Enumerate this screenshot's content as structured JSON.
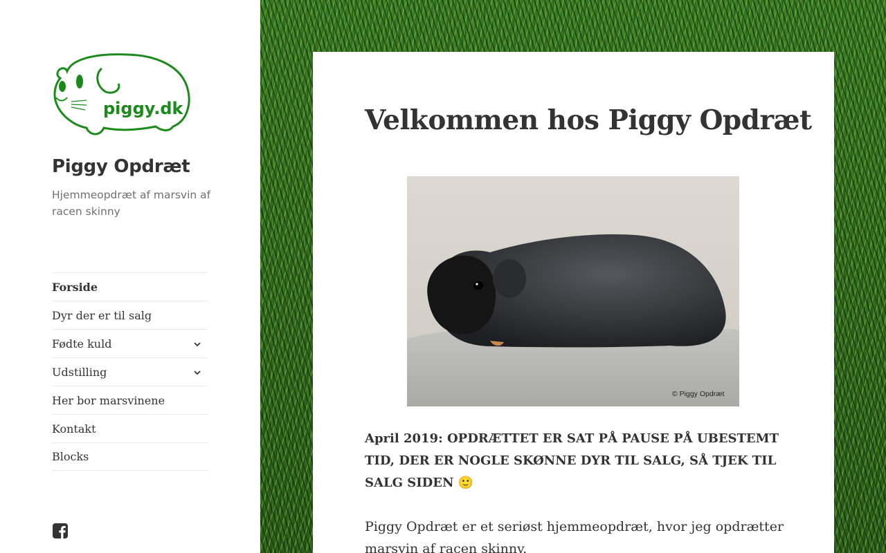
{
  "site": {
    "logo_text": "piggy.dk",
    "title": "Piggy Opdræt",
    "description": "Hjemmeopdræt af marsvin af racen skinny"
  },
  "nav": {
    "items": [
      {
        "label": "Forside",
        "active": true,
        "has_submenu": false
      },
      {
        "label": "Dyr der er til salg",
        "active": false,
        "has_submenu": false
      },
      {
        "label": "Fødte kuld",
        "active": false,
        "has_submenu": true
      },
      {
        "label": "Udstilling",
        "active": false,
        "has_submenu": true
      },
      {
        "label": "Her bor marsvinene",
        "active": false,
        "has_submenu": false
      },
      {
        "label": "Kontakt",
        "active": false,
        "has_submenu": false
      },
      {
        "label": "Blocks",
        "active": false,
        "has_submenu": false
      }
    ]
  },
  "social": {
    "icon": "facebook-icon"
  },
  "post": {
    "title": "Velkommen hos Piggy Opdræt",
    "image_caption": "© Piggy Opdræt",
    "notice": "April 2019: OPDRÆTTET ER SAT PÅ PAUSE PÅ UBESTEMT TID, DER ER NOGLE SKØNNE DYR TIL SALG, SÅ TJEK TIL SALG SIDEN 🙂",
    "intro": "Piggy Opdræt er et seriøst hjemmeopdræt, hvor jeg opdrætter marsvin af racen skinny."
  },
  "colors": {
    "logo_green": "#1a8a1a",
    "text": "#333333",
    "muted": "#707070",
    "grass": "#2f6b1f"
  }
}
